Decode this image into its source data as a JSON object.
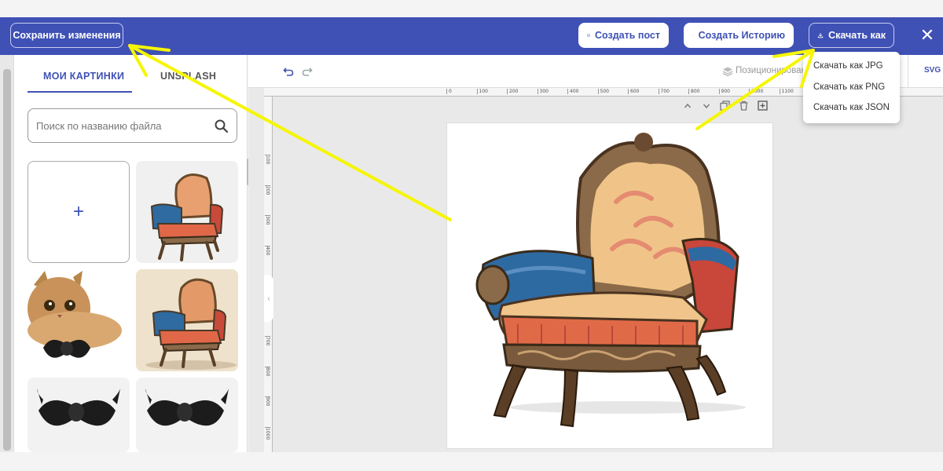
{
  "header": {
    "save_label": "Сохранить изменения",
    "create_post_label": "Создать пост",
    "create_story_label": "Создать Историю",
    "download_as_label": "Скачать как",
    "close_glyph": "✕"
  },
  "download_menu": {
    "items": [
      {
        "label": "Скачать как JPG"
      },
      {
        "label": "Скачать как PNG"
      },
      {
        "label": "Скачать как JSON"
      }
    ]
  },
  "sidebar": {
    "tabs": [
      {
        "label": "МОИ КАРТИНКИ",
        "active": true
      },
      {
        "label": "UNSPLASH",
        "active": false
      }
    ],
    "search": {
      "placeholder": "Поиск по названию файла",
      "value": ""
    },
    "add_glyph": "+",
    "images": [
      {
        "kind": "armchair"
      },
      {
        "kind": "cat-with-bowtie"
      },
      {
        "kind": "armchair-painting"
      },
      {
        "kind": "bowtie"
      },
      {
        "kind": "bowtie"
      }
    ]
  },
  "editor": {
    "position_label": "Позиционирование",
    "svg_label": "SVG",
    "ruler_top_ticks": [
      "0",
      "100",
      "200",
      "300",
      "400",
      "500",
      "600",
      "700",
      "800",
      "900",
      "1000",
      "1100"
    ],
    "ruler_left_ticks": [
      "100",
      "200",
      "300",
      "400",
      "500",
      "600",
      "700",
      "800",
      "900",
      "1000"
    ],
    "collapse_glyph": "‹"
  },
  "colors": {
    "brand": "#3f51b5",
    "annotation_arrow": "#f6f600"
  }
}
